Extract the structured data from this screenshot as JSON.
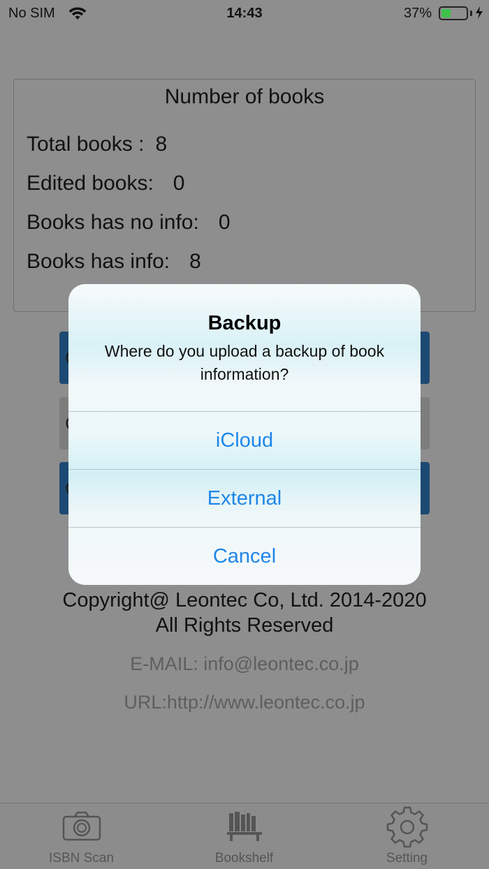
{
  "status_bar": {
    "carrier": "No SIM",
    "time": "14:43",
    "battery_percent": "37%",
    "battery_level": 0.37,
    "icons": [
      "wifi-icon",
      "battery-icon",
      "charging-bolt-icon"
    ]
  },
  "stats": {
    "title": "Number of books",
    "rows": [
      {
        "label": "Total books :",
        "value": "8"
      },
      {
        "label": "Edited books:",
        "value": "0"
      },
      {
        "label": "Books has no info:",
        "value": "0"
      },
      {
        "label": "Books has info:",
        "value": "8"
      }
    ]
  },
  "background_buttons": [
    {
      "label": "C",
      "color": "#1d4a73"
    },
    {
      "label": "C",
      "color": "#7d7d7d"
    },
    {
      "label": "C",
      "color": "#1d4a73"
    }
  ],
  "footer": {
    "copyright_line1": "Copyright@ Leontec Co, Ltd. 2014-2020",
    "copyright_line2": "All Rights Reserved",
    "email": "E-MAIL: info@leontec.co.jp",
    "url": "URL:http://www.leontec.co.jp"
  },
  "alert": {
    "title": "Backup",
    "message": "Where do you upload a backup of book information?",
    "actions": [
      {
        "label": "iCloud"
      },
      {
        "label": "External"
      },
      {
        "label": "Cancel"
      }
    ],
    "action_color": "#1f86e8"
  },
  "tab_bar": {
    "tabs": [
      {
        "label": "ISBN Scan",
        "icon": "camera-icon"
      },
      {
        "label": "Bookshelf",
        "icon": "bookshelf-icon"
      },
      {
        "label": "Setting",
        "icon": "gear-icon"
      }
    ]
  }
}
